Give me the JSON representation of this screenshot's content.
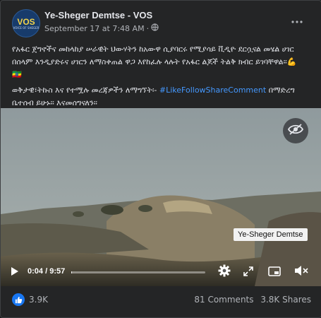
{
  "post": {
    "page_name": "Ye-Sheger Demtse - VOS",
    "timestamp": "September 17 at 7:48 AM",
    "separator": "·",
    "avatar_text": "VOS",
    "avatar_subtext": "VOICE OF SHEGER",
    "paragraph1": "የአፋር ጀግኖችና መከላከያ ሠራዊት ህውሃትን  ከአውዋ ሲያባርሩ የሚያሳይ ቪዲዮ ደርሷናል መሄል ሀገር በሰላም እንዲያድሩና ሀገርን ለማስቀጠል ዋጋ እየከፈሉ ላሉት የአፋር ልጆች ትልቅ ክብር ይገባቸዋል፡፡💪",
    "flag": "🇪🇹",
    "paragraph2_prefix": "ወቅታዊ፣ትኩስ እና የተሟሉ መረጃዎችን ለማግኘት፡- ",
    "hashtag": "#LikeFollowShareComment",
    "paragraph2_suffix": " በማድረግ ቤተሰብ ይሁኑ፡፡ እናመሰግናለን፡፡"
  },
  "video": {
    "watermark": "Ye-Sheger Demtse",
    "current_time": "0:04",
    "time_separator": " / ",
    "duration": "9:57",
    "progress": 0.0067
  },
  "footer": {
    "likes": "3.9K",
    "comments": "81 Comments",
    "shares": "3.8K Shares"
  },
  "colors": {
    "background": "#18191a",
    "card": "#242526",
    "hashtag": "#4599ff",
    "like_badge": "#1877f2"
  },
  "icons": [
    "more-icon",
    "globe-icon",
    "eye-icon",
    "play-icon",
    "settings-icon",
    "fullscreen-icon",
    "pip-icon",
    "mute-icon",
    "like-icon"
  ]
}
